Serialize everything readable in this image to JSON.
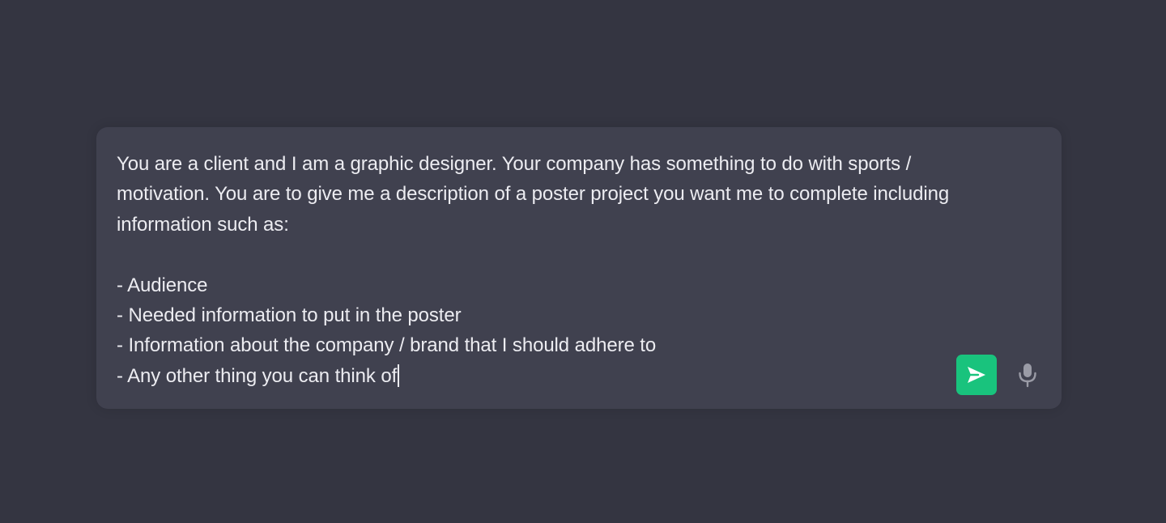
{
  "composer": {
    "lines": [
      "You are a client and I am a graphic designer. Your company has something to do with sports /",
      "motivation. You are to give me a description of a poster project you want me to complete including",
      "information such as:",
      "",
      "- Audience",
      "- Needed information to put in the poster",
      "- Information about the company / brand that I should adhere to",
      "- Any other thing you can think of"
    ],
    "send_icon": "send-arrow-icon",
    "mic_icon": "microphone-icon"
  },
  "colors": {
    "page_background": "#343541",
    "composer_background": "#40414f",
    "text": "#ececf1",
    "send_button": "#19c37d",
    "mic_icon": "#9a9ba6"
  }
}
